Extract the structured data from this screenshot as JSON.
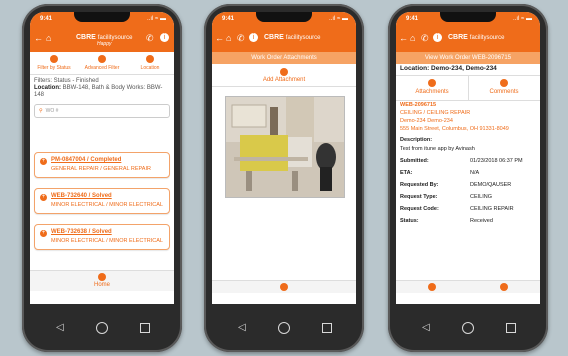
{
  "status": {
    "time": "9:41",
    "signal": "..ıl ≈ ▬"
  },
  "brand": {
    "name": "CBRE",
    "sub": "facilitysource",
    "tagline": "Happy"
  },
  "phone1": {
    "filters": [
      {
        "label": "Filter by Status",
        "icon": "filter-icon"
      },
      {
        "label": "Advanced Filter",
        "icon": "search-icon"
      },
      {
        "label": "Location",
        "icon": "pin-icon"
      }
    ],
    "filter_line": "Filters: Status - Finished",
    "location_label": "Location:",
    "location_value": "BBW-148, Bath & Body Works: BBW-148",
    "search_placeholder": "WO #",
    "cards": [
      {
        "title": "PM-0847004 / Completed",
        "sub": "GENERAL REPAIR / GENERAL REPAIR"
      },
      {
        "title": "WEB-732640 / Solved",
        "sub": "MINOR ELECTRICAL / MINOR ELECTRICAL"
      },
      {
        "title": "WEB-732638 / Solved",
        "sub": "MINOR ELECTRICAL / MINOR ELECTRICAL"
      }
    ],
    "home_label": "Home"
  },
  "phone2": {
    "subtitle": "Work Order Attachments",
    "add_label": "Add Attachment"
  },
  "phone3": {
    "subtitle": "View Work Order WEB-2096715",
    "location": "Location: Demo-234, Demo-234",
    "tab_attachments": "Attachments",
    "tab_comments": "Comments",
    "wo_lines": [
      "WEB-2096715",
      "CEILING / CEILING REPAIR",
      "Demo-234 Demo-234",
      "555 Main Street, Columbus, OH 91331-8049"
    ],
    "desc_label": "Description:",
    "desc_value": "Test from itune app by Avinash",
    "rows": [
      {
        "k": "Submitted:",
        "v": "01/23/2018 06:37 PM"
      },
      {
        "k": "ETA:",
        "v": "N/A"
      },
      {
        "k": "Requested By:",
        "v": "DEMO/QAUSER"
      },
      {
        "k": "Request Type:",
        "v": "CEILING"
      },
      {
        "k": "Request Code:",
        "v": "CEILING REPAIR"
      },
      {
        "k": "Status:",
        "v": "Received"
      }
    ]
  },
  "colors": {
    "accent": "#ef6c1a",
    "accent_light": "#f6a364"
  }
}
